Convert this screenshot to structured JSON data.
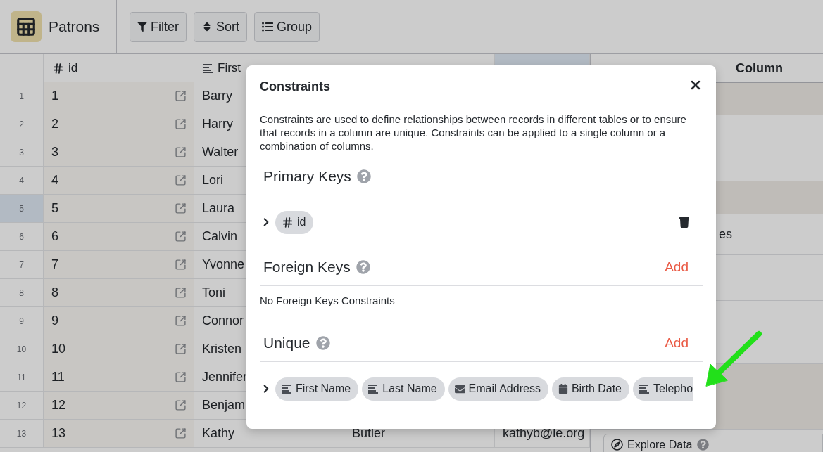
{
  "table_name": "Patrons",
  "toolbar": [
    {
      "label": "Filter",
      "kind": "filter"
    },
    {
      "label": "Sort",
      "kind": "sort"
    },
    {
      "label": "Group",
      "kind": "group"
    }
  ],
  "columns": [
    {
      "label": "id",
      "kind": "number",
      "selected": false
    },
    {
      "label": "First",
      "kind": "text",
      "selected": false
    },
    {
      "selected": false
    },
    {
      "selected": true
    }
  ],
  "rows": [
    {
      "number": "1",
      "id": "1",
      "first_name": "Barry",
      "selected": false
    },
    {
      "number": "2",
      "id": "2",
      "first_name": "Harry",
      "selected": false
    },
    {
      "number": "3",
      "id": "3",
      "first_name": "Walter",
      "selected": false
    },
    {
      "number": "4",
      "id": "4",
      "first_name": "Lori",
      "selected": false
    },
    {
      "number": "5",
      "id": "5",
      "first_name": "Laura",
      "selected": true
    },
    {
      "number": "6",
      "id": "6",
      "first_name": "Calvin",
      "selected": false
    },
    {
      "number": "7",
      "id": "7",
      "first_name": "Yvonne",
      "selected": false
    },
    {
      "number": "8",
      "id": "8",
      "first_name": "Toni",
      "selected": false
    },
    {
      "number": "9",
      "id": "9",
      "first_name": "Connor",
      "selected": false
    },
    {
      "number": "10",
      "id": "10",
      "first_name": "Kristen",
      "selected": false
    },
    {
      "number": "11",
      "id": "11",
      "first_name": "Jennifer",
      "selected": false
    },
    {
      "number": "12",
      "id": "12",
      "first_name": "Benjam",
      "selected": false
    },
    {
      "number": "13",
      "id": "13",
      "first_name": "Kathy",
      "last_name": "Butler",
      "email": "kathyb@le.org",
      "selected": false
    }
  ],
  "side_panel": {
    "column_header": "Column",
    "fragment": "es",
    "explore": "Explore Data"
  },
  "modal": {
    "title": "Constraints",
    "description": "Constraints are used to define relationships between records in different tables or to ensure that records in a column are unique. Constraints can be applied to a single column or a combination of columns.",
    "sections": [
      {
        "heading": "Primary Keys",
        "constraints": [
          {
            "deletable": true,
            "chips": [
              {
                "label": "id",
                "kind": "number",
                "clipped": false
              }
            ]
          }
        ]
      },
      {
        "heading": "Foreign Keys",
        "action": "Add",
        "empty": "No Foreign Keys Constraints"
      },
      {
        "heading": "Unique",
        "action": "Add",
        "constraints": [
          {
            "deletable": false,
            "chips": [
              {
                "label": "First Name",
                "kind": "text",
                "clipped": false
              },
              {
                "label": "Last Name",
                "kind": "text",
                "clipped": false
              },
              {
                "label": "Email Address",
                "kind": "email",
                "clipped": false
              },
              {
                "label": "Birth Date",
                "kind": "date",
                "clipped": false
              },
              {
                "label": "Telepho",
                "kind": "text",
                "clipped": true
              }
            ]
          }
        ]
      }
    ]
  }
}
